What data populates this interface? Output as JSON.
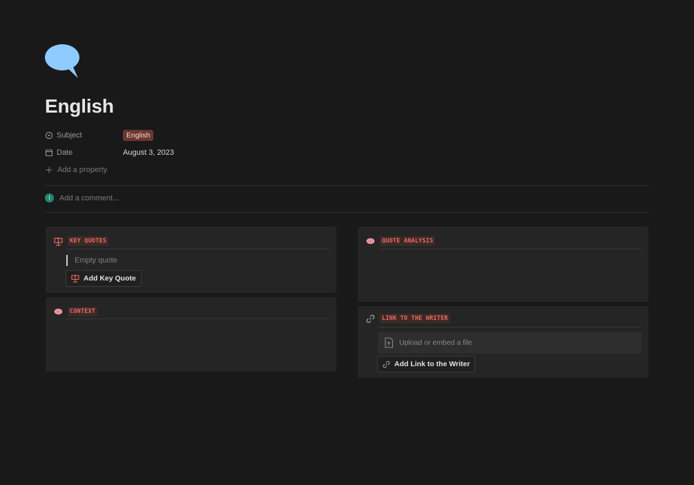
{
  "page": {
    "title": "English",
    "icon": "speech-bubble-icon",
    "accent_color": "#8ecbff"
  },
  "properties": [
    {
      "key": "Subject",
      "icon": "select-circle-icon",
      "value": "English",
      "type": "tag"
    },
    {
      "key": "Date",
      "icon": "calendar-icon",
      "value": "August 3, 2023",
      "type": "text"
    }
  ],
  "add_property": "Add a property",
  "comment": {
    "avatar_initial": "I",
    "placeholder": "Add a comment..."
  },
  "cards": {
    "key_quotes": {
      "label": "KEY QUOTES",
      "empty_text": "Empty quote",
      "button": "Add Key Quote"
    },
    "context": {
      "label": "CONTEXT"
    },
    "quote_analysis": {
      "label": "QUOTE ANALYSIS"
    },
    "link_writer": {
      "label": "LINK TO THE WRITER",
      "upload_text": "Upload or embed a file",
      "button": "Add Link to the Writer"
    }
  },
  "colors": {
    "tag_bg": "#6e3630",
    "label_red": "#ef6a5e",
    "background": "#191919",
    "card": "#252525"
  }
}
